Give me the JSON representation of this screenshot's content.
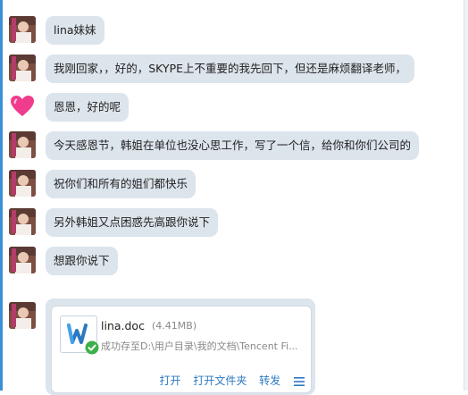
{
  "messages": [
    {
      "text": "lina妹妹",
      "avatar": "contact-avatar"
    },
    {
      "text": "我刚回家，，好的，SKYPE上不重要的我先回下，但还是麻烦翻译老师，",
      "avatar": "contact-avatar"
    },
    {
      "text": "恩恩，好的呢",
      "avatar": "heart-avatar"
    },
    {
      "text": "今天感恩节，韩姐在单位也没心思工作，写了一个信，给你和你们公司的",
      "avatar": "contact-avatar"
    },
    {
      "text": "祝你们和所有的姐们都快乐",
      "avatar": "contact-avatar"
    },
    {
      "text": "另外韩姐又点困惑先高跟你说下",
      "avatar": "contact-avatar"
    },
    {
      "text": "想跟你说下",
      "avatar": "contact-avatar"
    }
  ],
  "file_card": {
    "file_name": "lina.doc",
    "file_size": "(4.41MB)",
    "status": "成功存至D:\\用户目录\\我的文档\\Tencent Fi...",
    "icon": "word-document-icon",
    "actions": {
      "open": "打开",
      "open_folder": "打开文件夹",
      "forward": "转发"
    }
  },
  "colors": {
    "bubble": "#dce4ec",
    "link": "#2b79c2",
    "accent": "#3a8fd6"
  }
}
